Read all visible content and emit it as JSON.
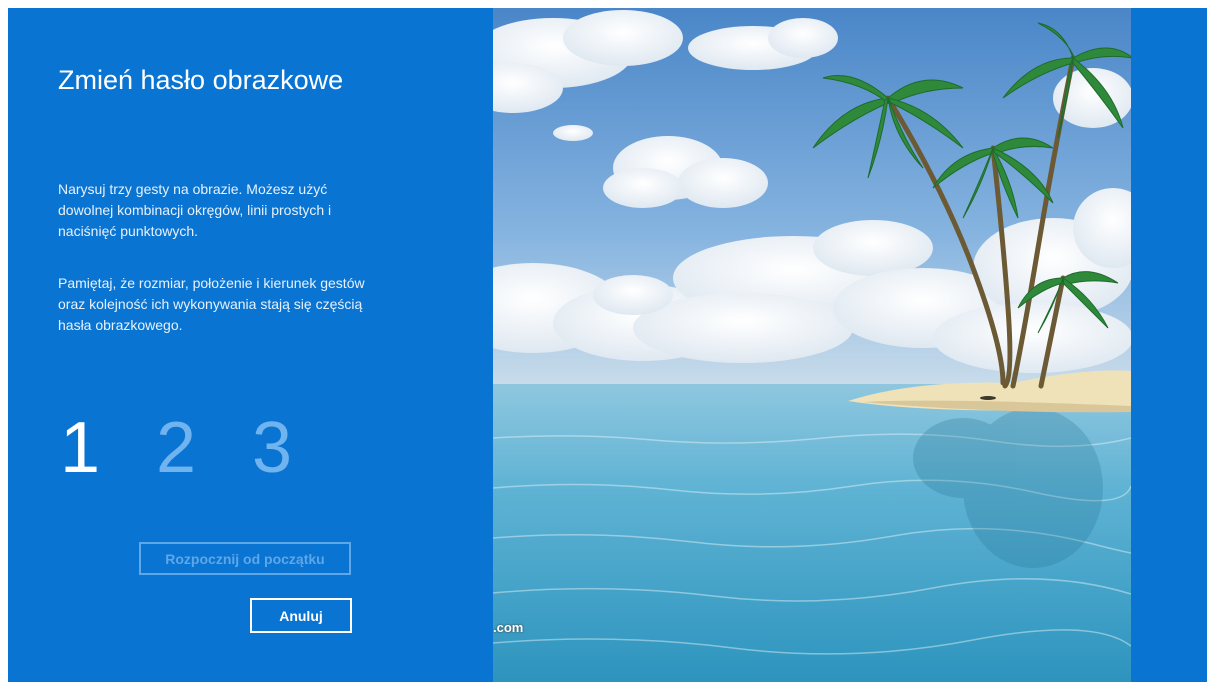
{
  "panel": {
    "title": "Zmień hasło obrazkowe",
    "paragraph_1": "Narysuj trzy gesty na obrazie. Możesz użyć dowolnej kombinacji okręgów, linii prostych i naciśnięć punktowych.",
    "paragraph_2": "Pamiętaj, że rozmiar, położenie i kierunek gestów oraz kolejność ich wykonywania stają się częścią hasła obrazkowego.",
    "steps": [
      "1",
      "2",
      "3"
    ],
    "active_step": 1,
    "restart_label": "Rozpocznij od początku",
    "cancel_label": "Anuluj"
  },
  "picture": {
    "watermark": ".com"
  },
  "colors": {
    "background": "#0a74d2",
    "step_inactive": "#6fb3ef"
  }
}
